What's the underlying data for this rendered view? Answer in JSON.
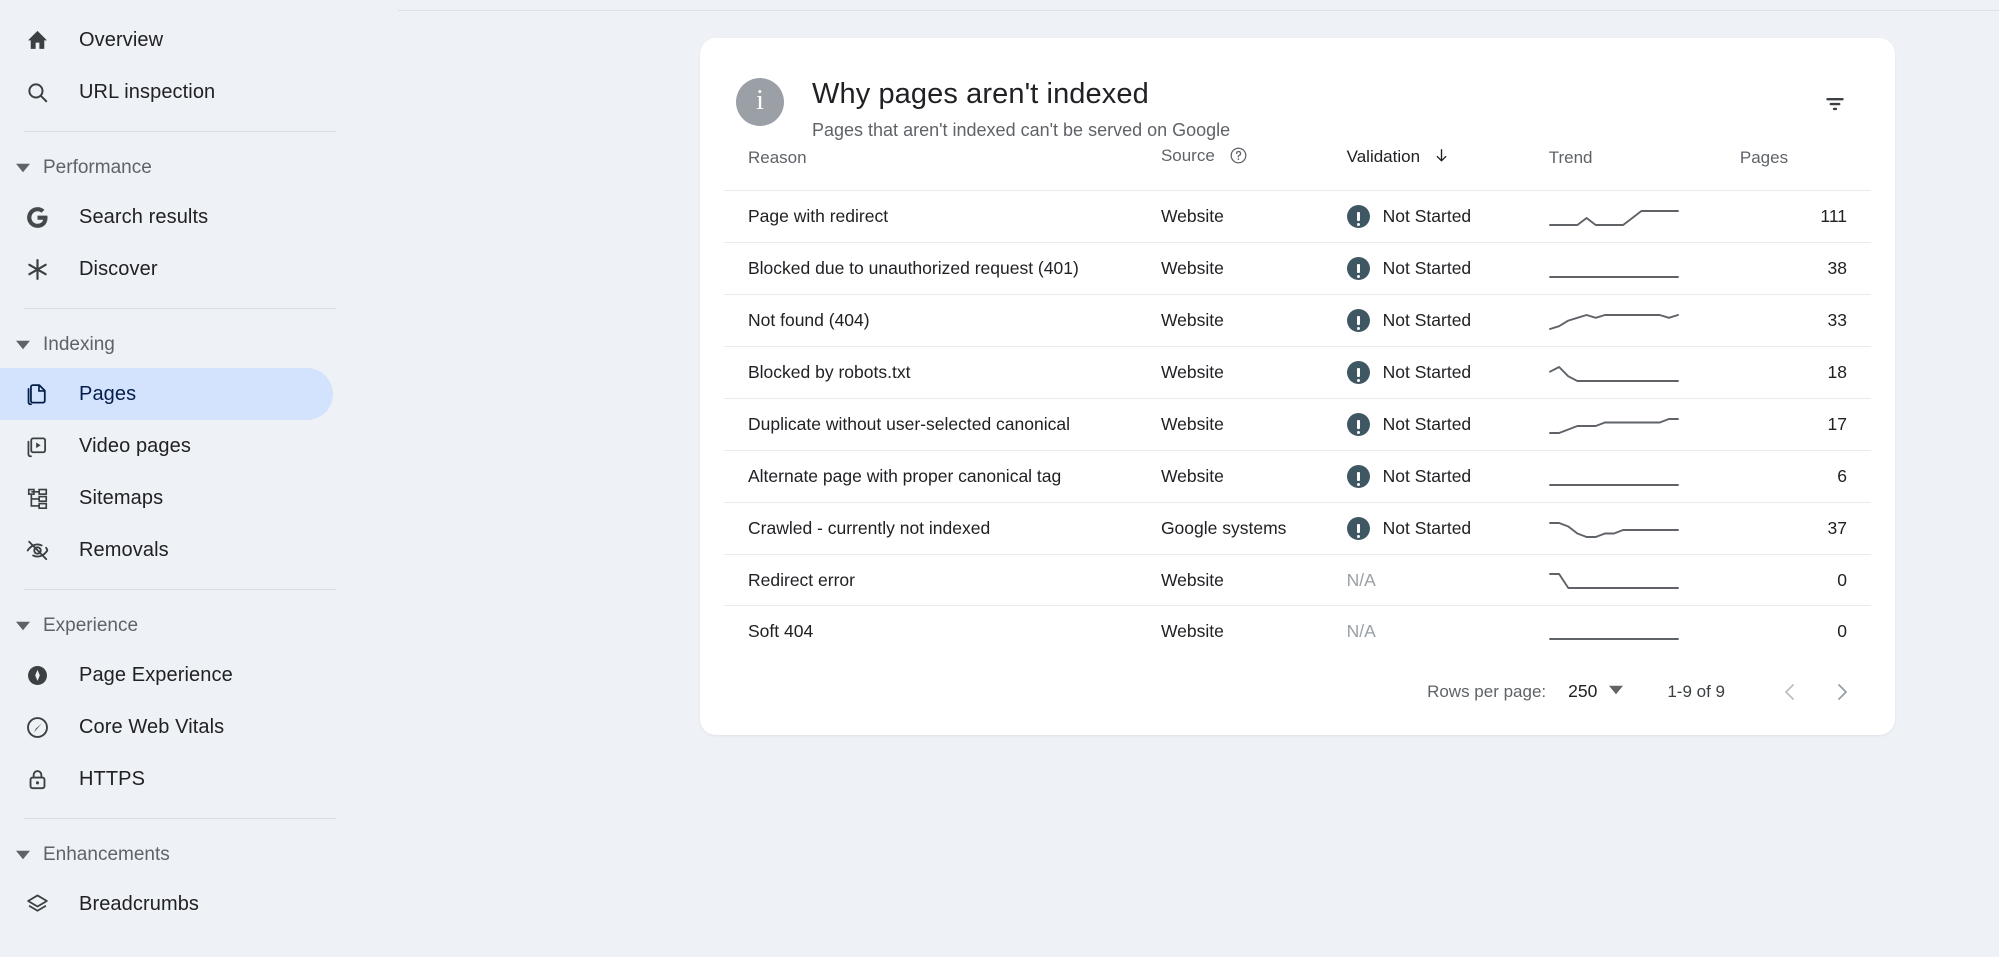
{
  "sidebar": {
    "top_items": [
      {
        "label": "Overview",
        "icon": "home-icon"
      },
      {
        "label": "URL inspection",
        "icon": "search-icon"
      }
    ],
    "sections": [
      {
        "title": "Performance",
        "items": [
          {
            "label": "Search results",
            "icon": "google-g-icon"
          },
          {
            "label": "Discover",
            "icon": "asterisk-icon"
          }
        ]
      },
      {
        "title": "Indexing",
        "items": [
          {
            "label": "Pages",
            "icon": "pages-icon",
            "selected": true
          },
          {
            "label": "Video pages",
            "icon": "video-pages-icon"
          },
          {
            "label": "Sitemaps",
            "icon": "sitemaps-icon"
          },
          {
            "label": "Removals",
            "icon": "eye-off-icon"
          }
        ]
      },
      {
        "title": "Experience",
        "items": [
          {
            "label": "Page Experience",
            "icon": "page-experience-icon"
          },
          {
            "label": "Core Web Vitals",
            "icon": "speedometer-icon"
          },
          {
            "label": "HTTPS",
            "icon": "lock-icon"
          }
        ]
      },
      {
        "title": "Enhancements",
        "items": [
          {
            "label": "Breadcrumbs",
            "icon": "layers-icon"
          }
        ]
      }
    ]
  },
  "card": {
    "title": "Why pages aren't indexed",
    "subtitle": "Pages that aren't indexed can't be served on Google",
    "info_glyph": "i",
    "filter_icon": "filter-icon"
  },
  "table": {
    "columns": [
      {
        "key": "reason",
        "label": "Reason"
      },
      {
        "key": "source",
        "label": "Source",
        "help": true
      },
      {
        "key": "validation",
        "label": "Validation",
        "sorted": "desc"
      },
      {
        "key": "trend",
        "label": "Trend"
      },
      {
        "key": "pages",
        "label": "Pages"
      }
    ],
    "rows": [
      {
        "reason": "Page with redirect",
        "source": "Website",
        "validation": "Not Started",
        "has_status_icon": true,
        "pages": "111",
        "trend": [
          10,
          10,
          10,
          10,
          11,
          10,
          10,
          10,
          10,
          11,
          12,
          12,
          12,
          12,
          12
        ]
      },
      {
        "reason": "Blocked due to unauthorized request (401)",
        "source": "Website",
        "validation": "Not Started",
        "has_status_icon": true,
        "pages": "38",
        "trend": [
          11,
          11,
          11,
          11,
          11,
          11,
          11,
          11,
          11,
          11,
          11,
          11,
          11,
          11,
          11
        ]
      },
      {
        "reason": "Not found (404)",
        "source": "Website",
        "validation": "Not Started",
        "has_status_icon": true,
        "pages": "33",
        "trend": [
          6,
          7,
          9,
          10,
          11,
          10,
          11,
          11,
          11,
          11,
          11,
          11,
          11,
          10,
          11
        ]
      },
      {
        "reason": "Blocked by robots.txt",
        "source": "Website",
        "validation": "Not Started",
        "has_status_icon": true,
        "pages": "18",
        "trend": [
          13,
          14,
          12,
          11,
          11,
          11,
          11,
          11,
          11,
          11,
          11,
          11,
          11,
          11,
          11
        ]
      },
      {
        "reason": "Duplicate without user-selected canonical",
        "source": "Website",
        "validation": "Not Started",
        "has_status_icon": true,
        "pages": "17",
        "trend": [
          9,
          9,
          10,
          11,
          11,
          11,
          12,
          12,
          12,
          12,
          12,
          12,
          12,
          13,
          13
        ]
      },
      {
        "reason": "Alternate page with proper canonical tag",
        "source": "Website",
        "validation": "Not Started",
        "has_status_icon": true,
        "pages": "6",
        "trend": [
          11,
          11,
          11,
          11,
          11,
          11,
          11,
          11,
          11,
          11,
          11,
          11,
          11,
          11,
          11
        ]
      },
      {
        "reason": "Crawled - currently not indexed",
        "source": "Google systems",
        "validation": "Not Started",
        "has_status_icon": true,
        "pages": "37",
        "trend": [
          13,
          13,
          12,
          10,
          9,
          9,
          10,
          10,
          11,
          11,
          11,
          11,
          11,
          11,
          11
        ]
      },
      {
        "reason": "Redirect error",
        "source": "Website",
        "validation": "N/A",
        "has_status_icon": false,
        "pages": "0",
        "trend": [
          13,
          13,
          11,
          11,
          11,
          11,
          11,
          11,
          11,
          11,
          11,
          11,
          11,
          11,
          11
        ]
      },
      {
        "reason": "Soft 404",
        "source": "Website",
        "validation": "N/A",
        "has_status_icon": false,
        "pages": "0",
        "trend": [
          11,
          11,
          11,
          11,
          11,
          11,
          11,
          11,
          11,
          11,
          11,
          11,
          11,
          11,
          11
        ]
      }
    ]
  },
  "footer": {
    "rows_per_page_label": "Rows per page:",
    "rows_per_page_value": "250",
    "range": "1-9 of 9",
    "prev_icon": "chevron-left-icon",
    "next_icon": "chevron-right-icon",
    "dropdown_icon": "caret-down-icon"
  },
  "colors": {
    "page_background": "#eef1f5",
    "card_background": "#ffffff",
    "selected_nav": "#d3e3fd",
    "status_icon": "#3f5763",
    "info_badge": "#9aa0a6",
    "text_primary": "#202124",
    "text_secondary": "#5f6368",
    "row_divider": "#e8eaed",
    "sparkline": "#5f6368"
  }
}
